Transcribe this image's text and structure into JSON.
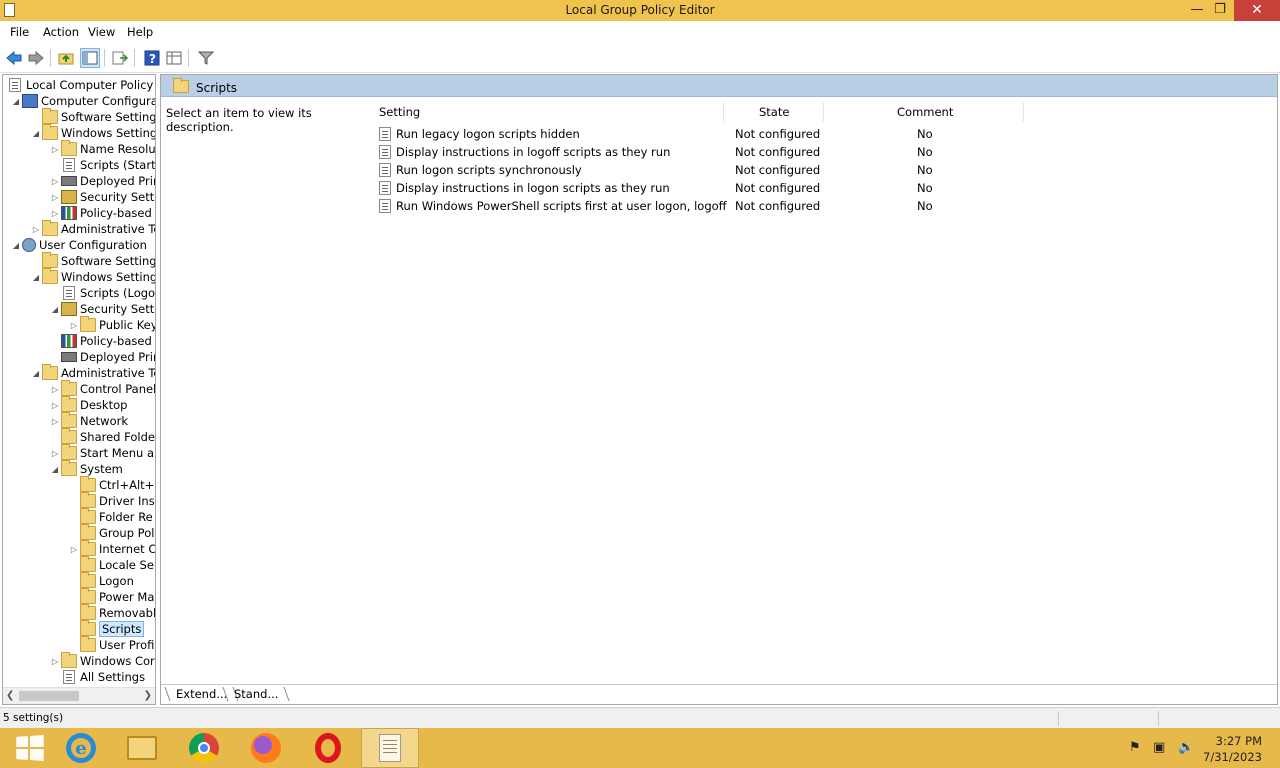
{
  "window": {
    "title": "Local Group Policy Editor",
    "minimize_icon": "minimize-icon",
    "maximize_icon": "restore-icon",
    "close_icon": "close-icon"
  },
  "menu": [
    "File",
    "Action",
    "View",
    "Help"
  ],
  "toolbar": [
    "back-arrow-icon",
    "forward-arrow-icon",
    "up-folder-icon",
    "show-hide-tree-icon",
    "export-list-icon",
    "help-icon",
    "extended-view-icon",
    "filter-icon"
  ],
  "tree": {
    "root": "Local Computer Policy",
    "items": [
      "Computer Configurat",
      "Software Settings",
      "Windows Setting",
      "Name Resolu",
      "Scripts (Startu",
      "Deployed Prir",
      "Security Settir",
      "Policy-based",
      "Administrative Te",
      "User Configuration",
      "Software Settings",
      "Windows Setting",
      "Scripts (Logor",
      "Security Settir",
      "Public Key",
      "Policy-based",
      "Deployed Prir",
      "Administrative Te",
      "Control Panel",
      "Desktop",
      "Network",
      "Shared Folde",
      "Start Menu ar",
      "System",
      "Ctrl+Alt+D",
      "Driver Ins",
      "Folder Re",
      "Group Pol",
      "Internet C",
      "Locale Se",
      "Logon",
      "Power Ma",
      "Removabl",
      "Scripts",
      "User Profi",
      "Windows Cor",
      "All Settings"
    ],
    "selected": "Scripts"
  },
  "right": {
    "header": "Scripts",
    "description": "Select an item to view its description.",
    "columns": {
      "setting": "Setting",
      "state": "State",
      "comment": "Comment"
    },
    "rows": [
      {
        "setting": "Run legacy logon scripts hidden",
        "state": "Not configured",
        "comment": "No"
      },
      {
        "setting": "Display instructions in logoff scripts as they run",
        "state": "Not configured",
        "comment": "No"
      },
      {
        "setting": "Run logon scripts synchronously",
        "state": "Not configured",
        "comment": "No"
      },
      {
        "setting": "Display instructions in logon scripts as they run",
        "state": "Not configured",
        "comment": "No"
      },
      {
        "setting": "Run Windows PowerShell scripts first at user logon, logoff",
        "state": "Not configured",
        "comment": "No"
      }
    ],
    "tabs": [
      "Extend...",
      "Stand..."
    ]
  },
  "status": {
    "text": "5 setting(s)"
  },
  "taskbar": {
    "apps": [
      "windows-start-icon",
      "internet-explorer-icon",
      "file-explorer-icon",
      "chrome-icon",
      "firefox-icon",
      "opera-icon",
      "notepad-icon"
    ],
    "time": "3:27 PM",
    "date": "7/31/2023"
  }
}
